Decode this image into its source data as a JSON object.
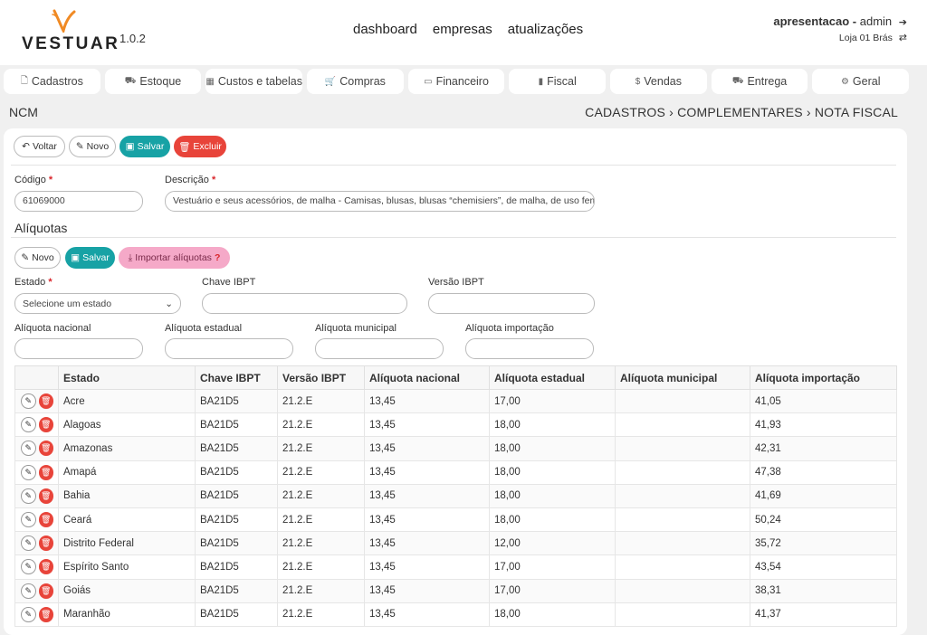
{
  "app": {
    "logo": "VESTUAR",
    "version": "1.0.2",
    "logo_color": "#f08a24"
  },
  "topnav": [
    {
      "label": "dashboard"
    },
    {
      "label": "empresas"
    },
    {
      "label": "atualizações"
    }
  ],
  "user": {
    "name": "apresentacao",
    "sep": " - ",
    "role": "admin",
    "store": "Loja 01 Brás"
  },
  "menu": [
    {
      "label": "Cadastros",
      "icon": "file-icon",
      "glyph": "🗋"
    },
    {
      "label": "Estoque",
      "icon": "truck-icon",
      "glyph": "⛟"
    },
    {
      "label": "Custos e tabelas",
      "icon": "table-icon",
      "glyph": "▦"
    },
    {
      "label": "Compras",
      "icon": "cart-icon",
      "glyph": "🛒"
    },
    {
      "label": "Financeiro",
      "icon": "credit-card-icon",
      "glyph": "▭"
    },
    {
      "label": "Fiscal",
      "icon": "document-icon",
      "glyph": "▮"
    },
    {
      "label": "Vendas",
      "icon": "dollar-icon",
      "glyph": "$"
    },
    {
      "label": "Entrega",
      "icon": "truck-icon",
      "glyph": "⛟"
    },
    {
      "label": "Geral",
      "icon": "gears-icon",
      "glyph": "⚙"
    }
  ],
  "page": {
    "title": "NCM",
    "breadcrumb": "CADASTROS › COMPLEMENTARES › NOTA FISCAL"
  },
  "toolbar": {
    "back": "Voltar",
    "new": "Novo",
    "save": "Salvar",
    "delete": "Excluir"
  },
  "form": {
    "codigo_label": "Código",
    "codigo_value": "61069000",
    "descricao_label": "Descrição",
    "descricao_value": "Vestuário e seus acessórios, de malha - Camisas, blusas, blusas “chemisiers”, de malha, de uso feminino"
  },
  "aliquotas": {
    "title": "Alíquotas",
    "new": "Novo",
    "save": "Salvar",
    "import": "Importar alíquotas",
    "import_help": "?",
    "estado_label": "Estado",
    "estado_placeholder": "Selecione um estado",
    "chave_label": "Chave IBPT",
    "versao_label": "Versão IBPT",
    "nacional_label": "Alíquota nacional",
    "estadual_label": "Alíquota estadual",
    "municipal_label": "Alíquota municipal",
    "importacao_label": "Alíquota importação"
  },
  "table": {
    "columns": [
      "",
      "Estado",
      "Chave IBPT",
      "Versão IBPT",
      "Alíquota nacional",
      "Alíquota estadual",
      "Alíquota municipal",
      "Alíquota importação"
    ],
    "rows": [
      [
        "Acre",
        "BA21D5",
        "21.2.E",
        "13,45",
        "17,00",
        "",
        "41,05"
      ],
      [
        "Alagoas",
        "BA21D5",
        "21.2.E",
        "13,45",
        "18,00",
        "",
        "41,93"
      ],
      [
        "Amazonas",
        "BA21D5",
        "21.2.E",
        "13,45",
        "18,00",
        "",
        "42,31"
      ],
      [
        "Amapá",
        "BA21D5",
        "21.2.E",
        "13,45",
        "18,00",
        "",
        "47,38"
      ],
      [
        "Bahia",
        "BA21D5",
        "21.2.E",
        "13,45",
        "18,00",
        "",
        "41,69"
      ],
      [
        "Ceará",
        "BA21D5",
        "21.2.E",
        "13,45",
        "18,00",
        "",
        "50,24"
      ],
      [
        "Distrito Federal",
        "BA21D5",
        "21.2.E",
        "13,45",
        "12,00",
        "",
        "35,72"
      ],
      [
        "Espírito Santo",
        "BA21D5",
        "21.2.E",
        "13,45",
        "17,00",
        "",
        "43,54"
      ],
      [
        "Goiás",
        "BA21D5",
        "21.2.E",
        "13,45",
        "17,00",
        "",
        "38,31"
      ],
      [
        "Maranhão",
        "BA21D5",
        "21.2.E",
        "13,45",
        "18,00",
        "",
        "41,37"
      ]
    ]
  }
}
